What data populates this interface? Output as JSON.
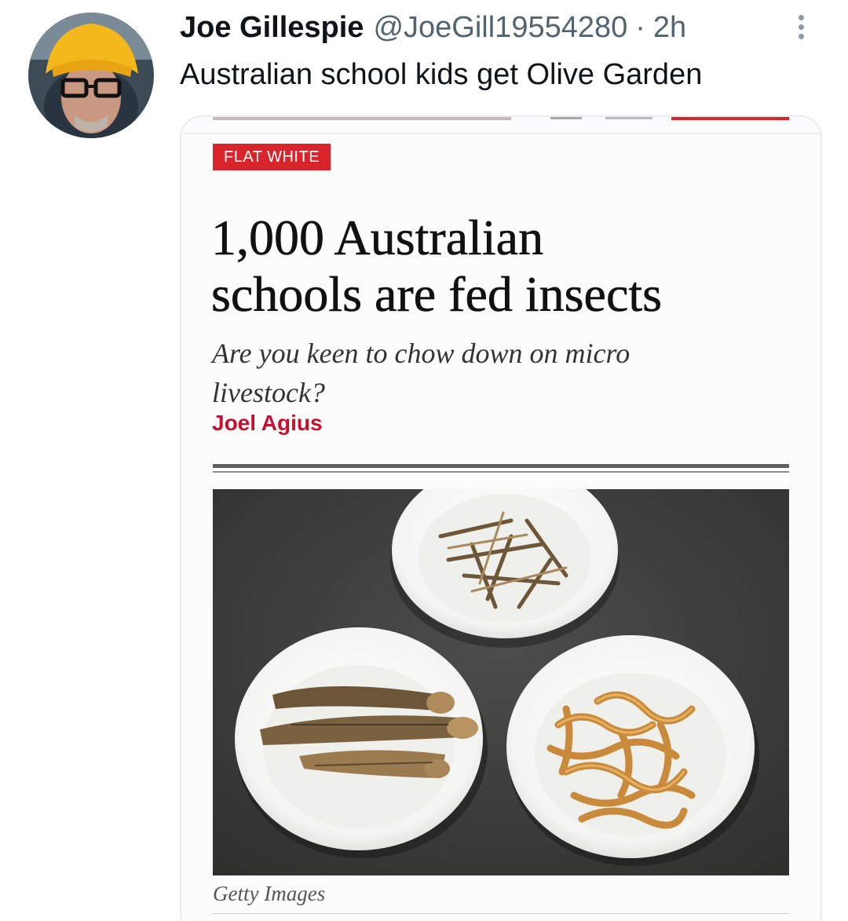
{
  "tweet": {
    "author": {
      "display_name": "Joe Gillespie",
      "handle": "@JoeGill19554280",
      "separator": "·",
      "time": "2h",
      "avatar_icon": "profile-photo"
    },
    "text": "Australian school kids get Olive Garden",
    "more_icon": "more-vertical-icon"
  },
  "article": {
    "section_tag": "FLAT WHITE",
    "headline_line1": "1,000 Australian",
    "headline_line2": "schools are fed insects",
    "subhead_line1": "Are you keen to chow down on micro",
    "subhead_line2": "livestock?",
    "author": "Joel Agius",
    "photo_caption": "Getty Images",
    "accent_color": "#d9242b"
  }
}
